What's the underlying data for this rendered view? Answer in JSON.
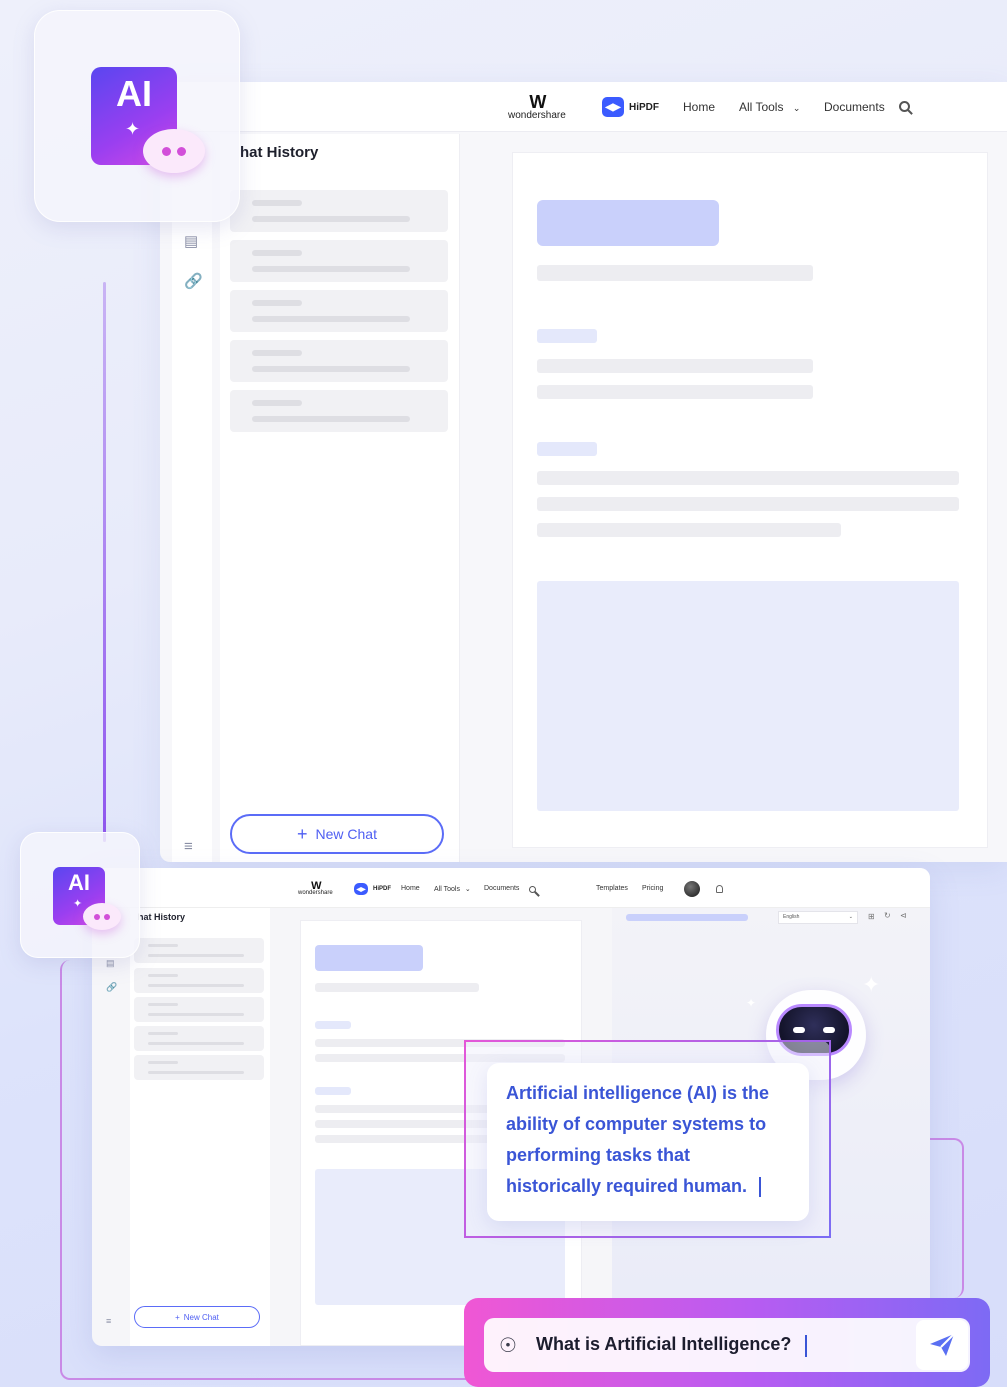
{
  "colors": {
    "accent": "#4e5ef2",
    "brand_gradient_start": "#f057d4",
    "brand_gradient_end": "#7d6af4",
    "answer_text": "#3a55d6"
  },
  "app_icon": {
    "label": "AI",
    "icon": "ai-chat-icon"
  },
  "top_window": {
    "brand": {
      "mark": "W",
      "name": "wondershare"
    },
    "product": {
      "logo": "hipdf-logo",
      "name": "HiPDF"
    },
    "nav": {
      "home": "Home",
      "all_tools": "All Tools",
      "documents": "Documents"
    },
    "sidebar": {
      "title": "hat History",
      "new_chat": "New Chat"
    }
  },
  "bottom_window": {
    "brand": {
      "mark": "W",
      "name": "wondershare"
    },
    "product": {
      "name": "HiPDF"
    },
    "nav": {
      "home": "Home",
      "all_tools": "All Tools",
      "documents": "Documents",
      "templates": "Templates",
      "pricing": "Pricing"
    },
    "sidebar": {
      "title": "hat History",
      "new_chat": "New Chat"
    },
    "language": "English"
  },
  "answer": {
    "lines": [
      "Artificial intelligence (AI) is the",
      "ability of computer systems to",
      "performing tasks that",
      "historically required human."
    ]
  },
  "prompt": {
    "text": "What is Artificial Intelligence?",
    "send_icon": "send-icon",
    "hint_icon": "bulb-icon"
  }
}
